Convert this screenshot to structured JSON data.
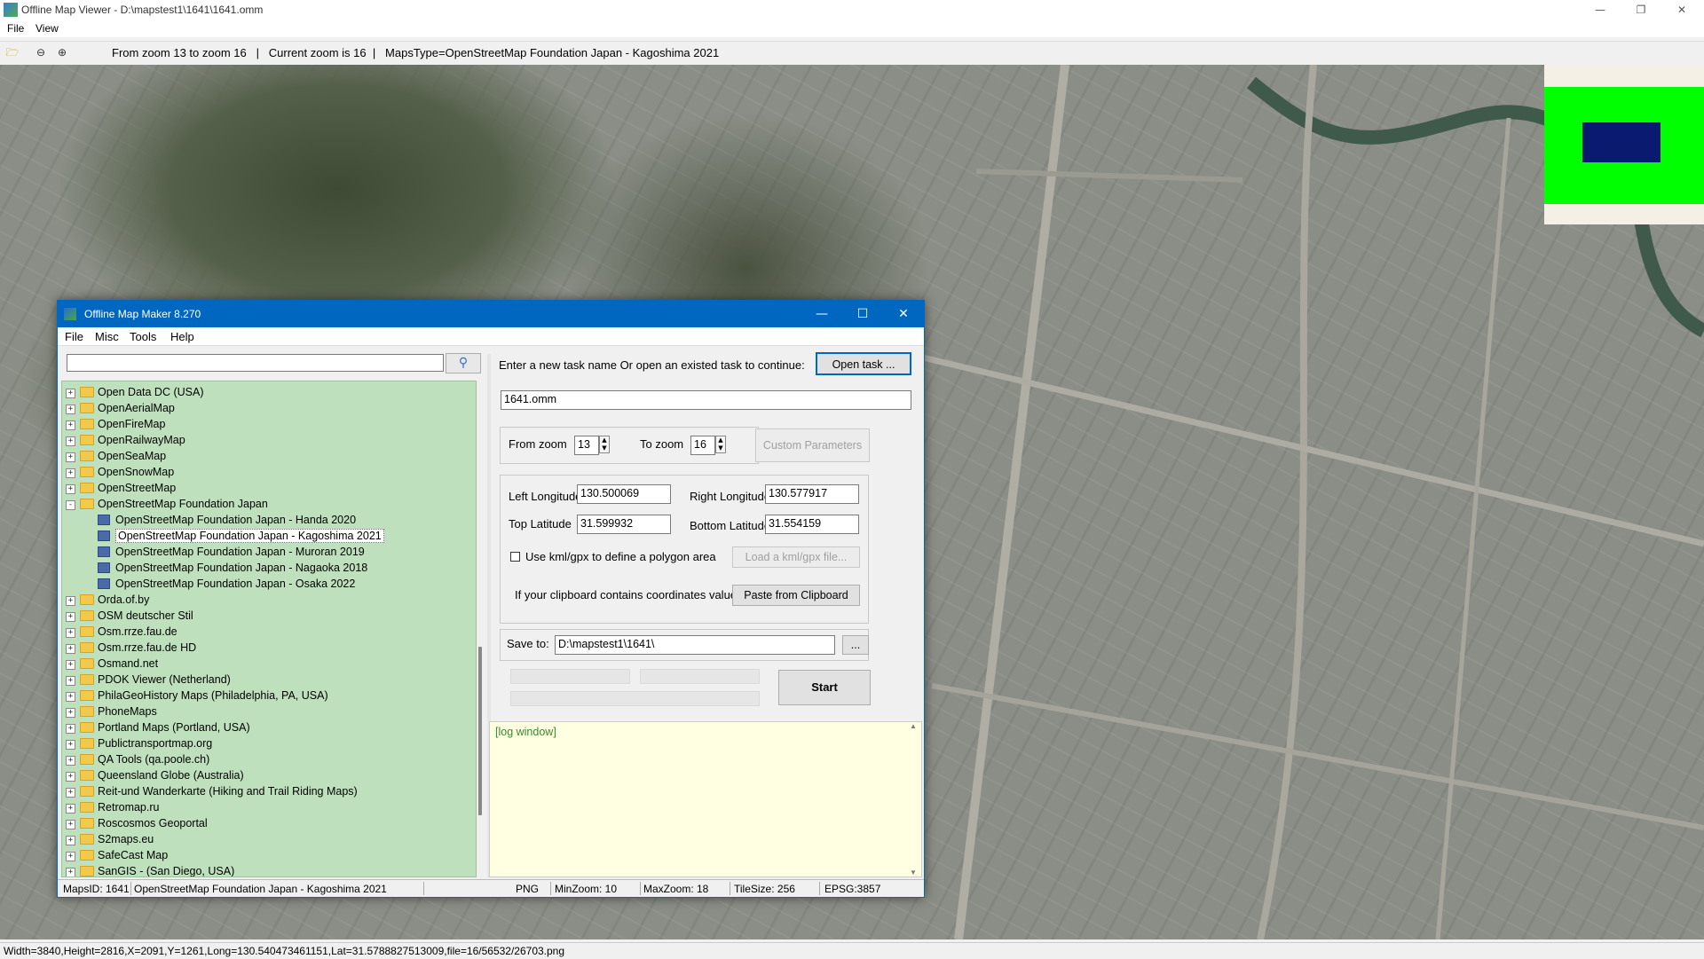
{
  "app": {
    "title": "Offline Map Viewer - D:\\mapstest1\\1641\\1641.omm",
    "menu": [
      "File",
      "View"
    ],
    "toolbar_info": "From zoom 13 to zoom 16   |   Current zoom is 16  |   MapsType=OpenStreetMap Foundation Japan - Kagoshima 2021",
    "status": "Width=3840,Height=2816,X=2091,Y=1261,Long=130.540473461151,Lat=31.5788827513009,file=16/56532/26703.png",
    "minimap_colors": {
      "background": "#00ff00",
      "viewport": "#0a1a6e"
    }
  },
  "dialog": {
    "title": "Offline Map Maker 8.270",
    "menu": [
      "File",
      "Misc",
      "Tools",
      "Help"
    ],
    "search_value": "",
    "tree": [
      {
        "label": "Open Data DC (USA)",
        "type": "folder"
      },
      {
        "label": "OpenAerialMap",
        "type": "folder"
      },
      {
        "label": "OpenFireMap",
        "type": "folder"
      },
      {
        "label": "OpenRailwayMap",
        "type": "folder"
      },
      {
        "label": "OpenSeaMap",
        "type": "folder"
      },
      {
        "label": "OpenSnowMap",
        "type": "folder"
      },
      {
        "label": "OpenStreetMap",
        "type": "folder"
      },
      {
        "label": "OpenStreetMap Foundation Japan",
        "type": "folder-open"
      },
      {
        "label": "OpenStreetMap Foundation Japan - Handa 2020",
        "type": "leaf"
      },
      {
        "label": "OpenStreetMap Foundation Japan - Kagoshima 2021",
        "type": "leaf",
        "selected": true
      },
      {
        "label": "OpenStreetMap Foundation Japan - Muroran 2019",
        "type": "leaf"
      },
      {
        "label": "OpenStreetMap Foundation Japan - Nagaoka 2018",
        "type": "leaf"
      },
      {
        "label": "OpenStreetMap Foundation Japan - Osaka 2022",
        "type": "leaf"
      },
      {
        "label": "Orda.of.by",
        "type": "folder"
      },
      {
        "label": "OSM deutscher Stil",
        "type": "folder"
      },
      {
        "label": "Osm.rrze.fau.de",
        "type": "folder"
      },
      {
        "label": "Osm.rrze.fau.de HD",
        "type": "folder"
      },
      {
        "label": "Osmand.net",
        "type": "folder"
      },
      {
        "label": "PDOK Viewer (Netherland)",
        "type": "folder"
      },
      {
        "label": "PhilaGeoHistory Maps (Philadelphia, PA, USA)",
        "type": "folder"
      },
      {
        "label": "PhoneMaps",
        "type": "folder"
      },
      {
        "label": "Portland Maps (Portland, USA)",
        "type": "folder"
      },
      {
        "label": "Publictransportmap.org",
        "type": "folder"
      },
      {
        "label": "QA Tools (qa.poole.ch)",
        "type": "folder"
      },
      {
        "label": "Queensland Globe (Australia)",
        "type": "folder"
      },
      {
        "label": "Reit-und Wanderkarte (Hiking and Trail Riding Maps)",
        "type": "folder"
      },
      {
        "label": "Retromap.ru",
        "type": "folder"
      },
      {
        "label": "Roscosmos Geoportal",
        "type": "folder"
      },
      {
        "label": "S2maps.eu",
        "type": "folder"
      },
      {
        "label": "SafeCast Map",
        "type": "folder"
      },
      {
        "label": "SanGIS - (San Diego, USA)",
        "type": "folder"
      }
    ],
    "task_prompt": "Enter a new task name Or open an existed task to continue:",
    "open_task_label": "Open task ...",
    "task_name": "1641.omm",
    "from_zoom_label": "From zoom",
    "from_zoom": "13",
    "to_zoom_label": "To zoom",
    "to_zoom": "16",
    "custom_params_label": "Custom Parameters",
    "left_lon_label": "Left Longitude",
    "left_lon": "130.500069",
    "right_lon_label": "Right Longitude",
    "right_lon": "130.577917",
    "top_lat_label": "Top Latitude",
    "top_lat": "31.599932",
    "bottom_lat_label": "Bottom Latitude",
    "bottom_lat": "31.554159",
    "kml_label": "Use kml/gpx to define a polygon area",
    "load_kml_label": "Load a kml/gpx file...",
    "clipboard_text": "If your clipboard contains coordinates values:",
    "paste_label": "Paste from Clipboard",
    "save_to_label": "Save to:",
    "save_to": "D:\\mapstest1\\1641\\",
    "browse_label": "...",
    "start_label": "Start",
    "log_text": "[log window]",
    "status": {
      "maps_id": "MapsID: 1641",
      "map_name": "OpenStreetMap Foundation Japan - Kagoshima 2021",
      "format": "PNG",
      "min_zoom": "MinZoom: 10",
      "max_zoom": "MaxZoom: 18",
      "tile_size": "TileSize: 256",
      "epsg": "EPSG:3857"
    }
  }
}
